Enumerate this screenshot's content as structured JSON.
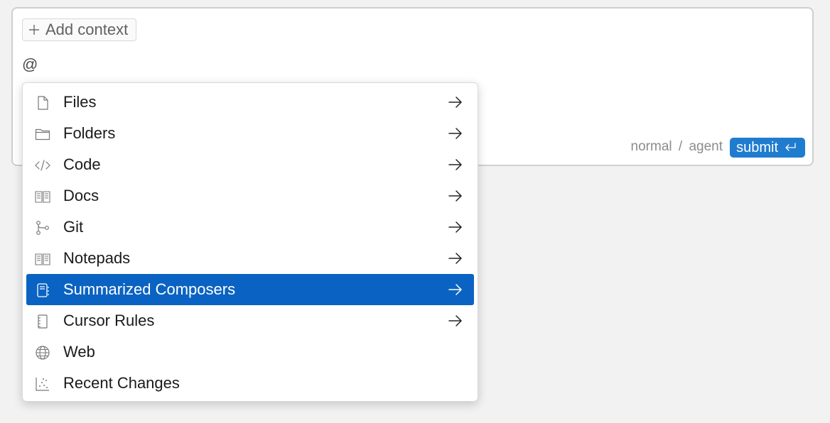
{
  "composer": {
    "add_context_label": "Add context",
    "input_text": "@",
    "mode_normal": "normal",
    "mode_separator": "/",
    "mode_agent": "agent",
    "submit_label": "submit"
  },
  "dropdown": {
    "items": [
      {
        "label": "Files",
        "icon": "file-icon",
        "has_arrow": true
      },
      {
        "label": "Folders",
        "icon": "folder-icon",
        "has_arrow": true
      },
      {
        "label": "Code",
        "icon": "code-icon",
        "has_arrow": true
      },
      {
        "label": "Docs",
        "icon": "book-icon",
        "has_arrow": true
      },
      {
        "label": "Git",
        "icon": "git-branch-icon",
        "has_arrow": true
      },
      {
        "label": "Notepads",
        "icon": "book-icon",
        "has_arrow": true
      },
      {
        "label": "Summarized Composers",
        "icon": "notebook-icon",
        "has_arrow": true,
        "selected": true
      },
      {
        "label": "Cursor Rules",
        "icon": "rules-icon",
        "has_arrow": true
      },
      {
        "label": "Web",
        "icon": "globe-icon",
        "has_arrow": false
      },
      {
        "label": "Recent Changes",
        "icon": "scatter-icon",
        "has_arrow": false
      }
    ]
  },
  "colors": {
    "accent": "#1f7ccf",
    "selected_bg": "#0a63c2",
    "page_bg": "#f2f2f2"
  }
}
